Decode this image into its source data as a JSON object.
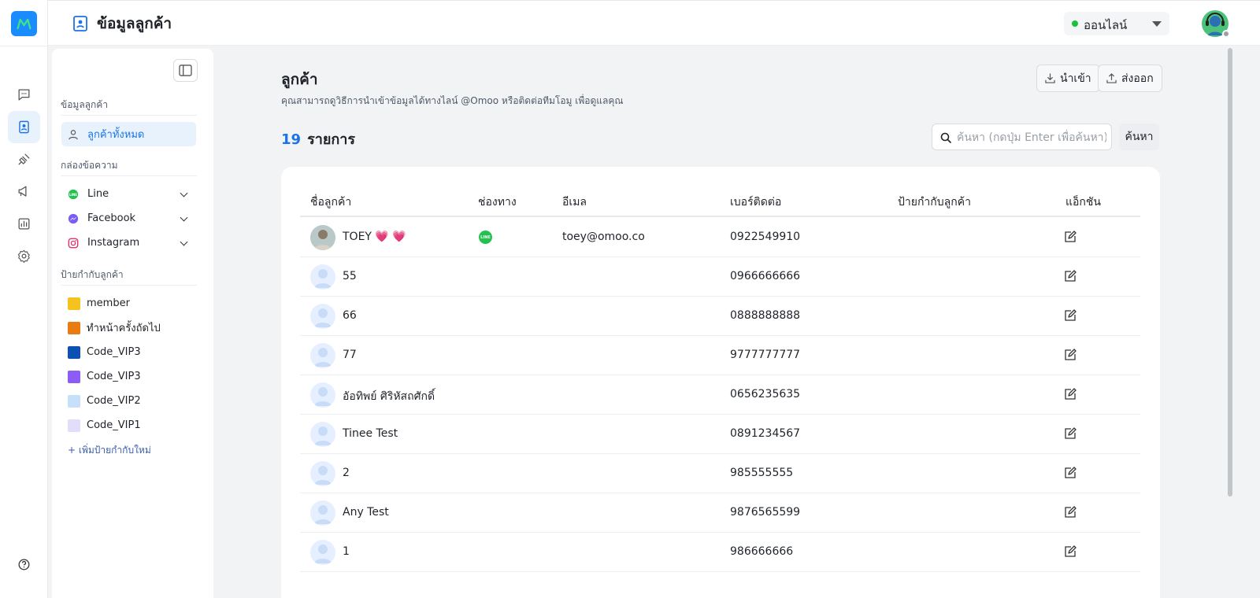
{
  "header": {
    "page_title": "ข้อมูลลูกค้า",
    "status_label": "ออนไลน์",
    "status_color": "#18c23a"
  },
  "rail": {
    "items": [
      "chat-icon",
      "contacts-icon",
      "integration-icon",
      "broadcast-icon",
      "report-icon",
      "settings-icon"
    ],
    "help_icon": "help-icon"
  },
  "sidebar": {
    "section_customers": "ข้อมูลลูกค้า",
    "all_customers": "ลูกค้าทั้งหมด",
    "section_inbox": "กล่องข้อความ",
    "channels": [
      {
        "label": "Line",
        "icon": "line-icon"
      },
      {
        "label": "Facebook",
        "icon": "messenger-icon"
      },
      {
        "label": "Instagram",
        "icon": "instagram-icon"
      }
    ],
    "section_tags": "ป้ายกำกับลูกค้า",
    "tags": [
      {
        "label": "member",
        "color": "#f6c21d"
      },
      {
        "label": "ทำหน้าครั้งถัดไป",
        "color": "#ea7a12"
      },
      {
        "label": "Code_VIP3",
        "color": "#0d4fb3"
      },
      {
        "label": "Code_VIP3",
        "color": "#8b5cf6"
      },
      {
        "label": "Code_VIP2",
        "color": "#c7e0fa"
      },
      {
        "label": "Code_VIP1",
        "color": "#e3ddfa"
      }
    ],
    "add_tag": "+ เพิ่มป้ายกำกับใหม่"
  },
  "main": {
    "title": "ลูกค้า",
    "subtitle": "คุณสามารถดูวิธีการนำเข้าข้อมูลได้ทางไลน์ @Omoo หรือติดต่อทีมโอมู เพื่อดูแลคุณ",
    "import_label": "นำเข้า",
    "export_label": "ส่งออก",
    "count_number": "19",
    "count_label": "รายการ",
    "search_placeholder": "ค้นหา (กดปุ่ม Enter เพื่อค้นหา)",
    "search_button": "ค้นหา"
  },
  "table": {
    "columns": {
      "name": "ชื่อลูกค้า",
      "channel": "ช่องทาง",
      "email": "อีเมล",
      "phone": "เบอร์ติดต่อ",
      "tags": "ป้ายกำกับลูกค้า",
      "action": "แอ็กชัน"
    },
    "rows": [
      {
        "name": "TOEY 💗 💗",
        "channel": "LINE",
        "email": "toey@omoo.co",
        "phone": "0922549910"
      },
      {
        "name": "55",
        "channel": "",
        "email": "",
        "phone": "0966666666"
      },
      {
        "name": "66",
        "channel": "",
        "email": "",
        "phone": "0888888888"
      },
      {
        "name": "77",
        "channel": "",
        "email": "",
        "phone": "9777777777"
      },
      {
        "name": "อัอทิพย์ ศิริหัสถศักดิ์",
        "channel": "",
        "email": "",
        "phone": "0656235635"
      },
      {
        "name": "Tinee Test",
        "channel": "",
        "email": "",
        "phone": "0891234567"
      },
      {
        "name": "2",
        "channel": "",
        "email": "",
        "phone": "985555555"
      },
      {
        "name": "Any Test",
        "channel": "",
        "email": "",
        "phone": "9876565599"
      },
      {
        "name": "1",
        "channel": "",
        "email": "",
        "phone": "986666666"
      }
    ]
  }
}
